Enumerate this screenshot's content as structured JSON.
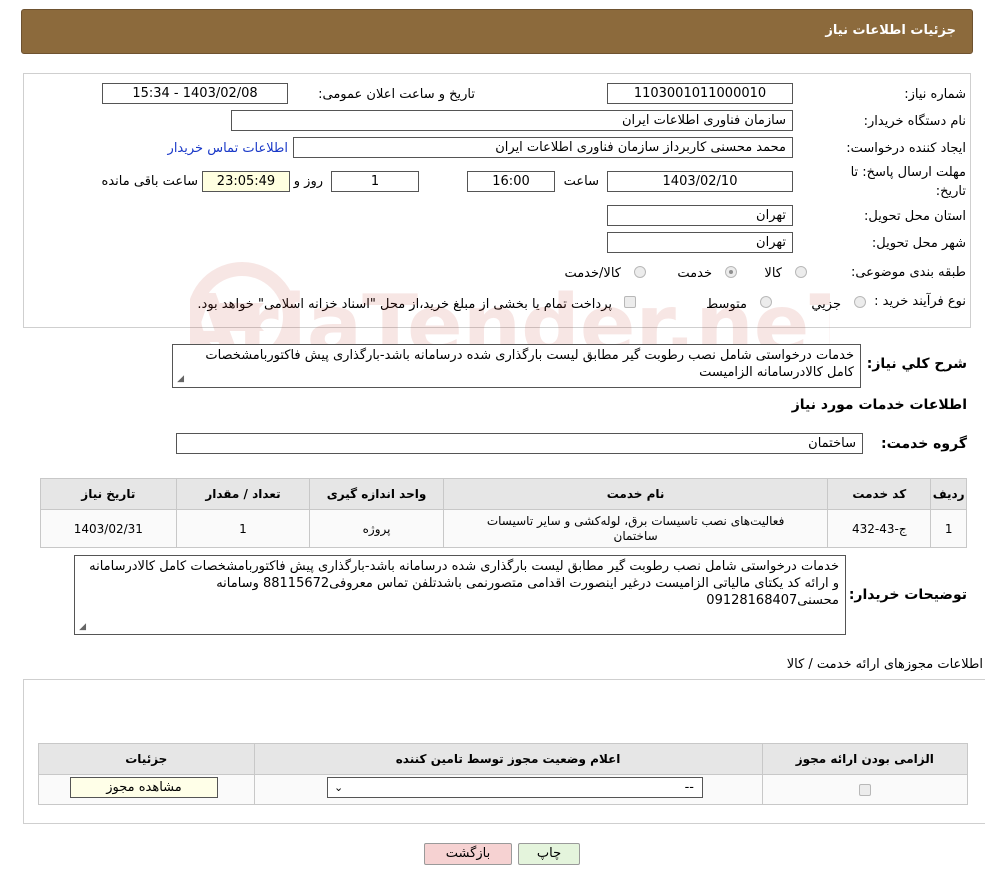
{
  "header": {
    "title": "جزئیات اطلاعات نیاز"
  },
  "fields": {
    "need_number_label": "شماره نیاز:",
    "need_number": "1103001011000010",
    "announce_label": "تاریخ و ساعت اعلان عمومی:",
    "announce_value": "1403/02/08 - 15:34",
    "buyer_org_label": "نام دستگاه خریدار:",
    "buyer_org": "سازمان فناوری اطلاعات ایران",
    "creator_label": "ایجاد کننده درخواست:",
    "creator": "محمد محسنی کاربرداز سازمان فناوری اطلاعات ایران",
    "contact_link": "اطلاعات تماس خریدار",
    "deadline_label_1": "مهلت ارسال پاسخ: تا",
    "deadline_label_2": "تاریخ:",
    "deadline_date": "1403/02/10",
    "time_label": "ساعت",
    "deadline_time": "16:00",
    "days": "1",
    "days_label": "روز و",
    "remaining_time": "23:05:49",
    "remaining_label": "ساعت باقی مانده",
    "province_label": "استان محل تحویل:",
    "province": "تهران",
    "city_label": "شهر محل تحویل:",
    "city": "تهران",
    "category_label": "طبقه بندی موضوعی:",
    "category_options": [
      "کالا",
      "خدمت",
      "کالا/خدمت"
    ],
    "purchase_type_label": "نوع فرآیند خرید :",
    "purchase_options": [
      "جزیي",
      "متوسط"
    ],
    "purchase_note": "پرداخت تمام یا بخشی از مبلغ خرید،از محل \"اسناد خزانه اسلامی\" خواهد بود."
  },
  "description": {
    "label": "شرح كلي نياز:",
    "text": "خدمات درخواستی شامل نصب رطوبت گیر مطابق لیست بارگذاری شده درسامانه باشد-بارگذاری پیش فاکتوربامشخصات کامل کالادرسامانه الزامیست"
  },
  "services": {
    "section_title": "اطلاعات خدمات مورد نياز",
    "group_label": "گروه خدمت:",
    "group_value": "ساختمان",
    "columns": [
      "رديف",
      "کد خدمت",
      "نام خدمت",
      "واحد اندازه گیری",
      "تعداد / مقدار",
      "تاریخ نیاز"
    ],
    "rows": [
      {
        "index": "1",
        "code": "ج-43-432",
        "name": "فعالیت‌های نصب تاسیسات برق، لوله‌کشی و سایر تاسیسات ساختمان",
        "unit": "پروژه",
        "qty": "1",
        "date": "1403/02/31"
      }
    ]
  },
  "buyer_notes": {
    "label": "توضیحات خریدار:",
    "text": "خدمات درخواستی شامل نصب رطوبت گیر مطابق لیست بارگذاری شده درسامانه باشد-بارگذاری پیش فاکتوربامشخصات کامل کالادرسامانه و ارائه کد یکتای مالیاتی الزامیست درغیر اینصورت اقدامی متصورنمی باشدتلفن تماس معروفی88115672 وسامانه محسنی09128168407"
  },
  "permits": {
    "section_title": "اطلاعات مجوزهای ارائه خدمت / کالا",
    "columns": [
      "الزامی بودن ارائه مجوز",
      "اعلام وضعیت مجوز توسط تامین کننده",
      "جزئیات"
    ],
    "select_value": "--",
    "view_button": "مشاهده مجوز"
  },
  "buttons": {
    "print": "چاپ",
    "back": "بازگشت"
  },
  "watermark": {
    "text": "AriaTender.neT"
  },
  "colors": {
    "header_bg": "#8c6a3c",
    "link": "#1a39c8",
    "back_btn": "#f6d2d2",
    "print_btn": "#e4f4dc"
  }
}
